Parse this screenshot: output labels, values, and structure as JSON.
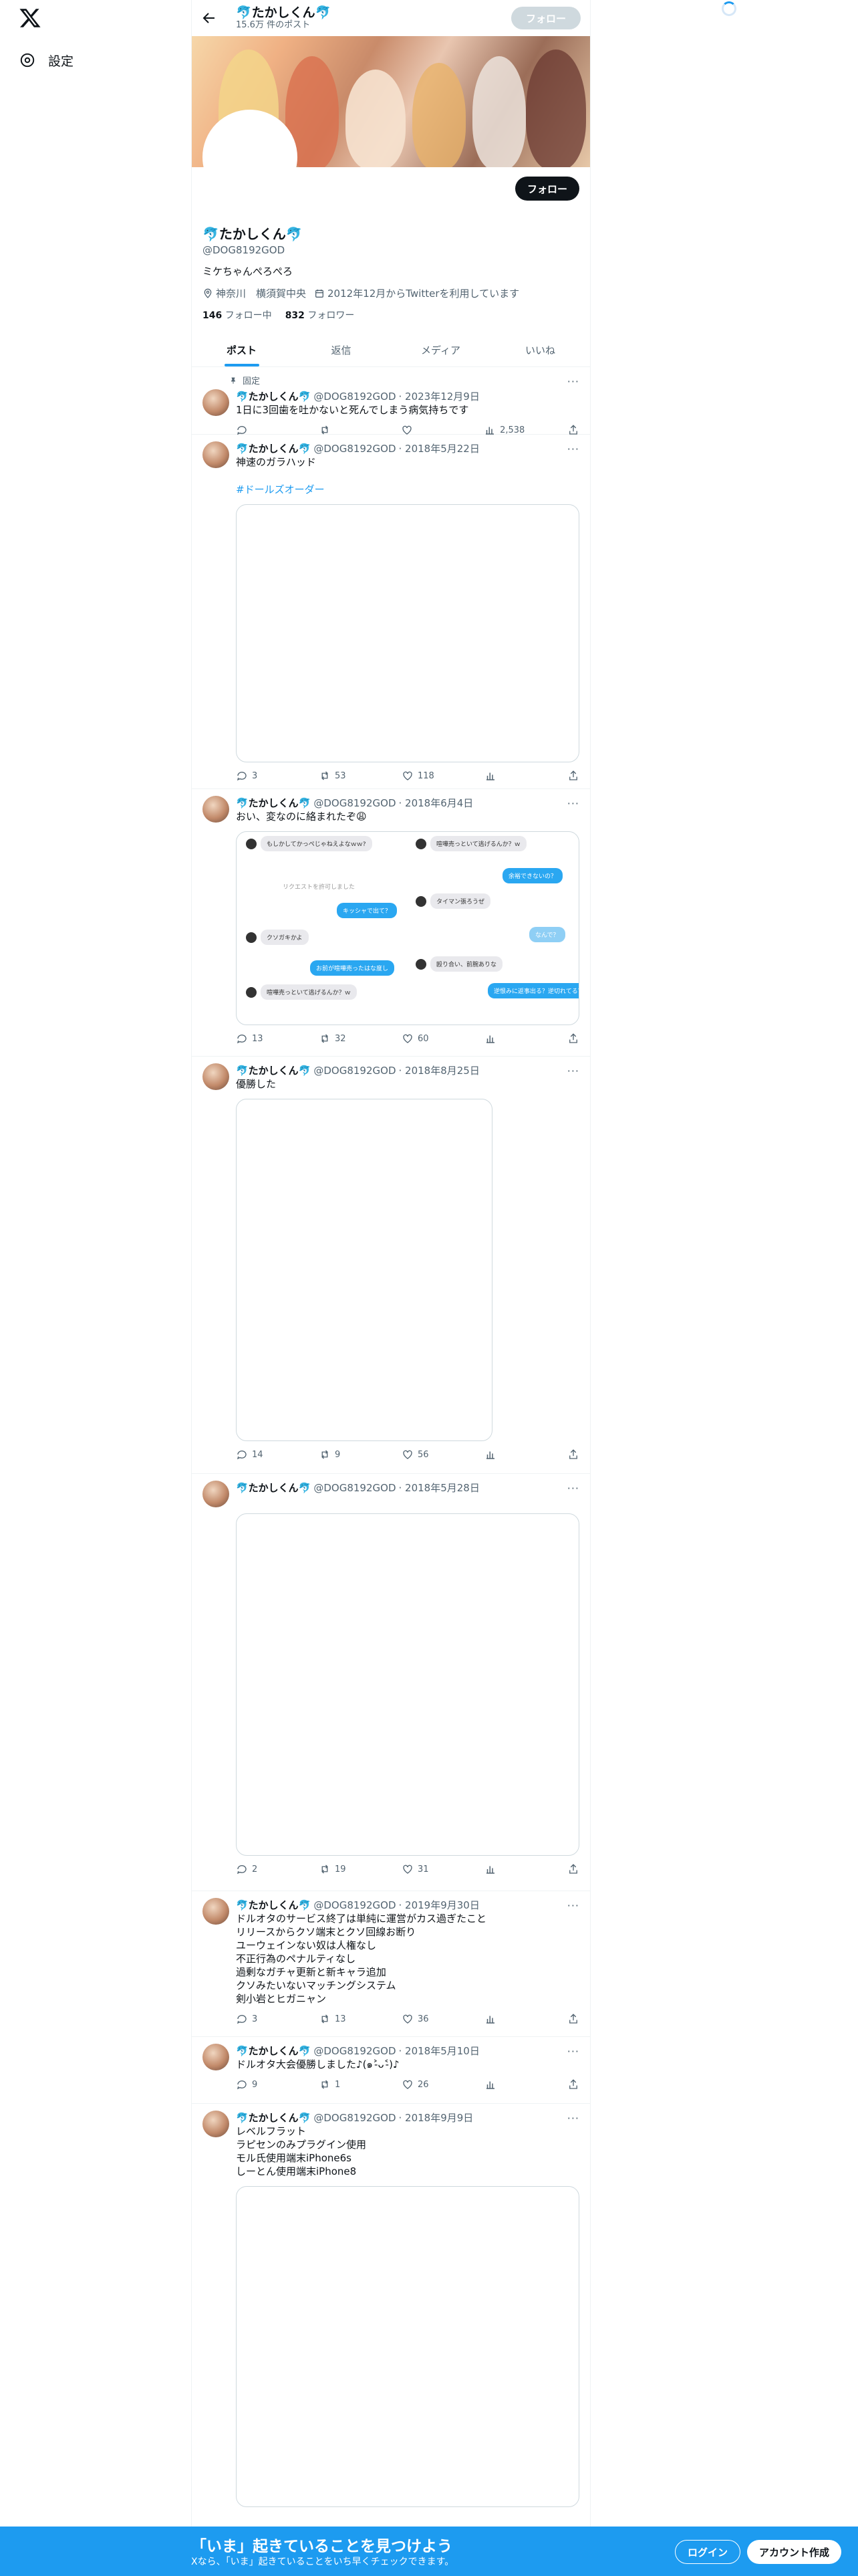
{
  "nav": {
    "settings_label": "設定"
  },
  "header": {
    "name": "🐬たかしくん🐬",
    "post_count": "15.6万 件のポスト",
    "follow_label": "フォロー"
  },
  "profile": {
    "follow_label": "フォロー",
    "name": "🐬たかしくん🐬",
    "handle": "@DOG8192GOD",
    "bio": "ミケちゃんぺろぺろ",
    "location": "神奈川　横須賀中央",
    "joined": "2012年12月からTwitterを利用しています",
    "following_count": "146",
    "following_label": "フォロー中",
    "followers_count": "832",
    "followers_label": "フォロワー"
  },
  "tabs": [
    "ポスト",
    "返信",
    "メディア",
    "いいね"
  ],
  "pinned_label": "固定",
  "posts": [
    {
      "name": "🐬たかしくん🐬",
      "handle": "@DOG8192GOD",
      "date": "· 2023年12月9日",
      "text": "1日に3回歯を吐かないと死んでしまう病気持ちです",
      "replies": "",
      "reposts": "",
      "likes": "",
      "views": "2,538"
    },
    {
      "name": "🐬たかしくん🐬",
      "handle": "@DOG8192GOD",
      "date": "· 2018年5月22日",
      "text": "神速のガラハッド",
      "link": "#ドールズオーダー",
      "replies": "3",
      "reposts": "53",
      "likes": "118",
      "views": ""
    },
    {
      "name": "🐬たかしくん🐬",
      "handle": "@DOG8192GOD",
      "date": "· 2018年6月4日",
      "text": "おい、変なのに絡まれたぞ😩",
      "replies": "13",
      "reposts": "32",
      "likes": "60",
      "views": ""
    },
    {
      "name": "🐬たかしくん🐬",
      "handle": "@DOG8192GOD",
      "date": "· 2018年8月25日",
      "text": "優勝した",
      "replies": "14",
      "reposts": "9",
      "likes": "56",
      "views": ""
    },
    {
      "name": "🐬たかしくん🐬",
      "handle": "@DOG8192GOD",
      "date": "· 2018年5月28日",
      "text": "",
      "replies": "2",
      "reposts": "19",
      "likes": "31",
      "views": ""
    },
    {
      "name": "🐬たかしくん🐬",
      "handle": "@DOG8192GOD",
      "date": "· 2019年9月30日",
      "text": "ドルオタのサービス終了は単純に運営がカス過ぎたこと\nリリースからクソ端末とクソ回線お断り\nユーウェインない奴は人権なし\n不正行為のペナルティなし\n過剰なガチャ更新と新キャラ追加\nクソみたいないマッチングシステム\n剣小岩とヒガニャン",
      "replies": "3",
      "reposts": "13",
      "likes": "36",
      "views": ""
    },
    {
      "name": "🐬たかしくん🐬",
      "handle": "@DOG8192GOD",
      "date": "· 2018年5月10日",
      "text": "ドルオタ大会優勝しました♪(๑˃̵ᴗ˂̵)♪",
      "replies": "9",
      "reposts": "1",
      "likes": "26",
      "views": ""
    },
    {
      "name": "🐬たかしくん🐬",
      "handle": "@DOG8192GOD",
      "date": "· 2018年9月9日",
      "text": "レベルフラット\nラピセンのみプラグイン使用\nモル氏使用端末iPhone6s\nしーとん使用端末iPhone8",
      "replies": "",
      "reposts": "",
      "likes": "",
      "views": ""
    }
  ],
  "chat": {
    "messages": [
      "もしかしてかっぺじゃねえよなｗｗ?",
      "喧嘩売っといて逃げるんか？ｗ",
      "リクエストを許可しました",
      "余裕できないの？",
      "タイマン張ろうぜ",
      "キッシャで出て？",
      "なんで？",
      "クソガキかよ",
      "お前が喧嘩売ったはな度し",
      "殴り合い、前腕ありな",
      "喧嘩売っといて逃げるんか？ｗ",
      "逆恨みに返事出る？逆切れてる？"
    ]
  },
  "bottom": {
    "title": "「いま」起きていることを見つけよう",
    "subtitle": "Xなら、「いま」起きていることをいち早くチェックできます。",
    "login": "ログイン",
    "signup": "アカウント作成"
  }
}
